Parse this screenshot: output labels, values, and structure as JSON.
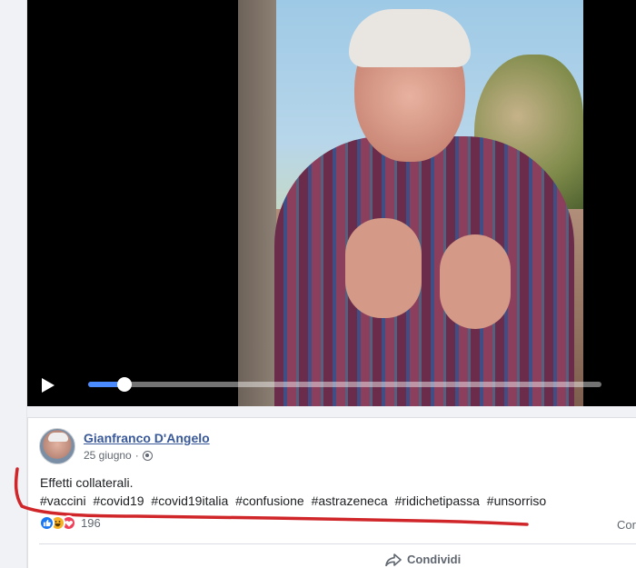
{
  "post": {
    "author": "Gianfranco D'Angelo",
    "date": "25 giugno",
    "separator": "·",
    "text_line1": "Effetti collaterali.",
    "hashtags": [
      "#vaccini",
      "#covid19",
      "#covid19italia",
      "#confusione",
      "#astrazeneca",
      "#ridichetipassa",
      "#unsorriso"
    ],
    "reaction_count": "196",
    "comments_label_partial": "Cor",
    "share_label": "Condividi"
  },
  "video": {
    "progress": 0.07
  },
  "icons": {
    "reactions": [
      "like-icon",
      "haha-icon",
      "love-icon"
    ],
    "privacy": "globe-icon",
    "share": "share-arrow-icon",
    "play": "play-icon"
  },
  "colors": {
    "author_link": "#385898",
    "progress_fill": "#4a8cff",
    "annotation": "#d0262a"
  }
}
